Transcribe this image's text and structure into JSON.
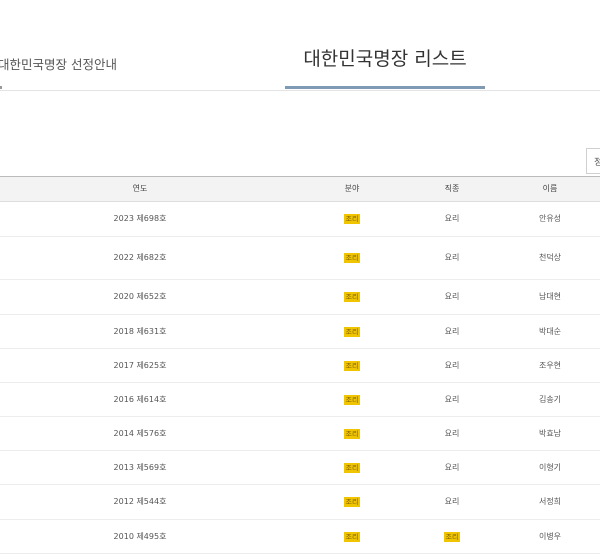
{
  "tabs": {
    "left_label": "대한민국명장 선정안내",
    "active_label": "대한민국명장 리스트"
  },
  "sort_button": {
    "label": "정렬"
  },
  "table": {
    "headers": {
      "year": "연도",
      "field": "분야",
      "type": "직종",
      "name": "이름"
    },
    "rows": [
      {
        "year": "2023 제698호",
        "field": "조리",
        "type": "요리",
        "type_is_badge": false,
        "name": "안유성"
      },
      {
        "year": "2022 제682호",
        "field": "조리",
        "type": "요리",
        "type_is_badge": false,
        "name": "천덕상"
      },
      {
        "year": "2020 제652호",
        "field": "조리",
        "type": "요리",
        "type_is_badge": false,
        "name": "남대현"
      },
      {
        "year": "2018 제631호",
        "field": "조리",
        "type": "요리",
        "type_is_badge": false,
        "name": "박대순"
      },
      {
        "year": "2017 제625호",
        "field": "조리",
        "type": "요리",
        "type_is_badge": false,
        "name": "조우현"
      },
      {
        "year": "2016 제614호",
        "field": "조리",
        "type": "요리",
        "type_is_badge": false,
        "name": "김송기"
      },
      {
        "year": "2014 제576호",
        "field": "조리",
        "type": "요리",
        "type_is_badge": false,
        "name": "박효남"
      },
      {
        "year": "2013 제569호",
        "field": "조리",
        "type": "요리",
        "type_is_badge": false,
        "name": "이형기"
      },
      {
        "year": "2012 제544호",
        "field": "조리",
        "type": "요리",
        "type_is_badge": false,
        "name": "서정희"
      },
      {
        "year": "2010 제495호",
        "field": "조리",
        "type": "조리",
        "type_is_badge": true,
        "name": "이병우"
      }
    ]
  },
  "colors": {
    "badge": "#f1c400",
    "tab_underline": "#7f9ab5"
  }
}
